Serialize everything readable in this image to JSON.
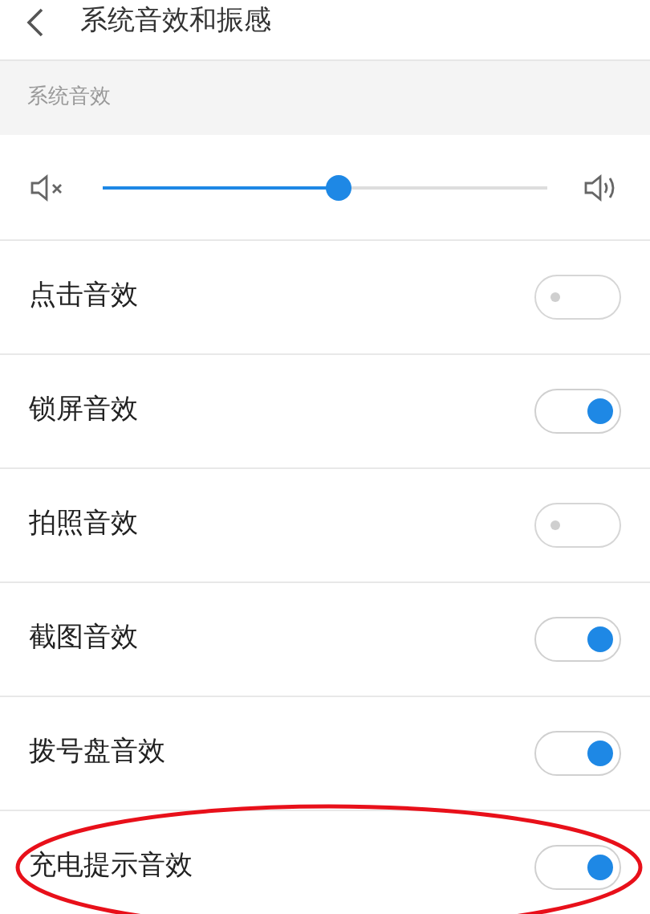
{
  "header": {
    "title": "系统音效和振感"
  },
  "section": {
    "label": "系统音效"
  },
  "volume": {
    "level": 0.53
  },
  "settings": [
    {
      "label": "点击音效",
      "on": false
    },
    {
      "label": "锁屏音效",
      "on": true
    },
    {
      "label": "拍照音效",
      "on": false
    },
    {
      "label": "截图音效",
      "on": true
    },
    {
      "label": "拨号盘音效",
      "on": true
    },
    {
      "label": "充电提示音效",
      "on": true,
      "circled": true
    }
  ]
}
